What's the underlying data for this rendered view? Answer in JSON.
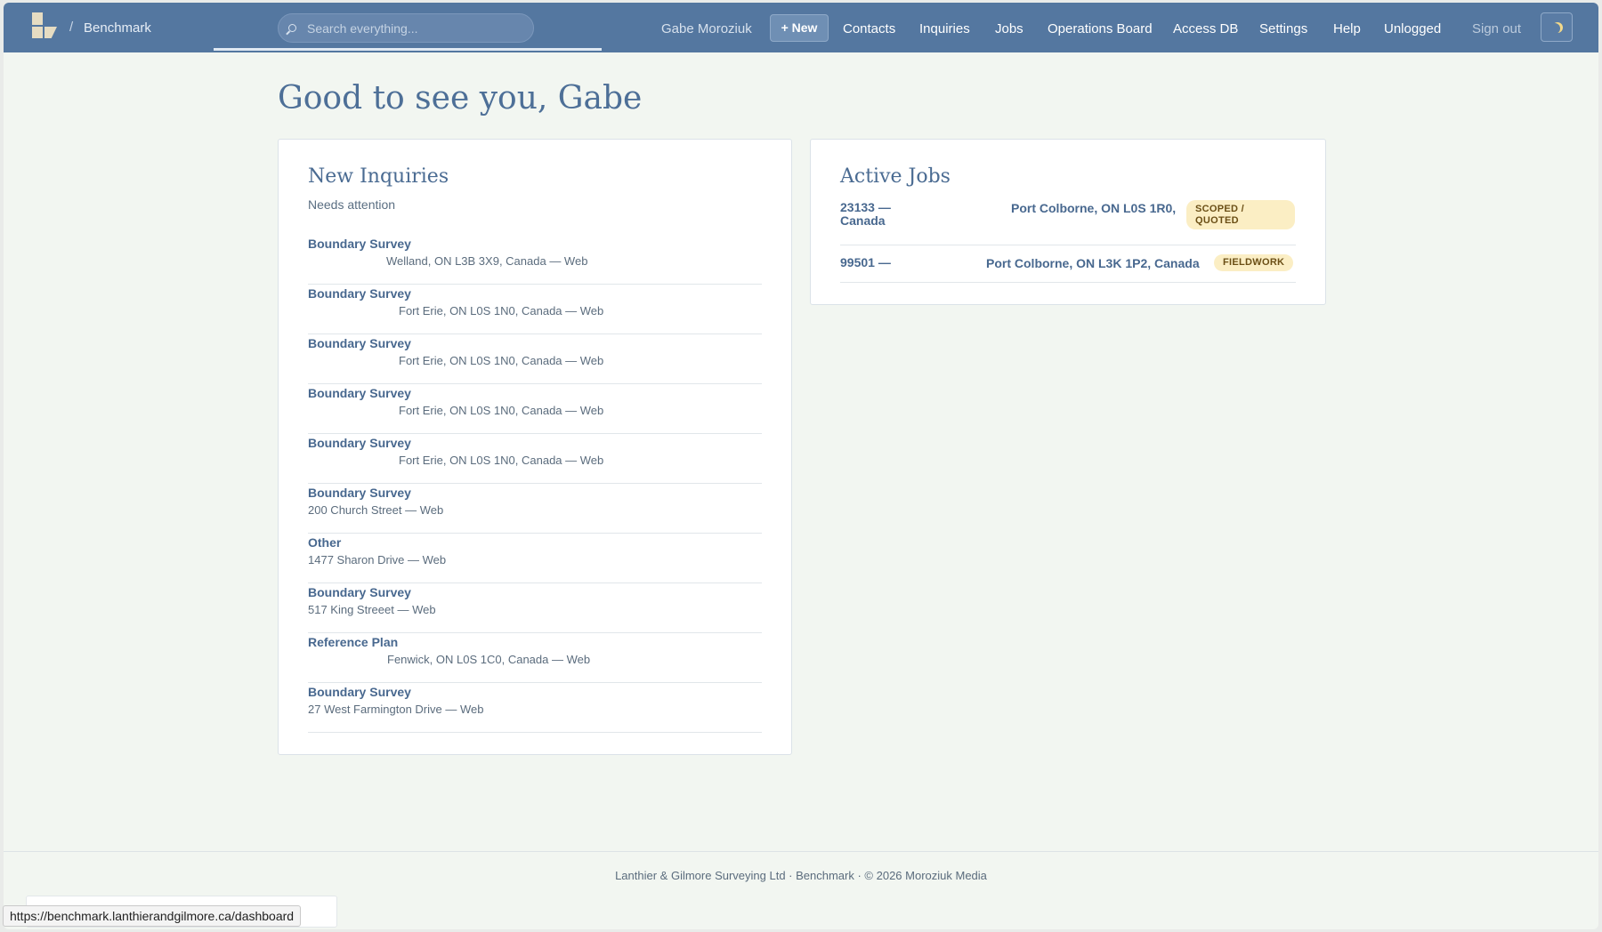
{
  "nav": {
    "app_name": "Benchmark",
    "crumb_separator": "/",
    "search_placeholder": "Search everything...",
    "user": "Gabe Moroziuk",
    "new_button": "+ New",
    "items": [
      "Contacts",
      "Inquiries",
      "Jobs",
      "Operations Board",
      "Access DB",
      "Settings",
      "Help",
      "Unlogged"
    ],
    "sign_out": "Sign out",
    "theme_icon": "moon-icon"
  },
  "greeting": "Good to see you, Gabe",
  "inquiries": {
    "title": "New Inquiries",
    "subtitle": "Needs attention",
    "items": [
      {
        "type": "Boundary Survey",
        "meta": "Welland, ON L3B 3X9, Canada — Web"
      },
      {
        "type": "Boundary Survey",
        "meta": "Fort Erie, ON L0S 1N0, Canada — Web"
      },
      {
        "type": "Boundary Survey",
        "meta": "Fort Erie, ON L0S 1N0, Canada — Web"
      },
      {
        "type": "Boundary Survey",
        "meta": "Fort Erie, ON L0S 1N0, Canada — Web"
      },
      {
        "type": "Boundary Survey",
        "meta": "Fort Erie, ON L0S 1N0, Canada — Web"
      },
      {
        "type": "Boundary Survey",
        "meta": "200 Church Street — Web"
      },
      {
        "type": "Other",
        "meta": "1477 Sharon Drive — Web"
      },
      {
        "type": "Boundary Survey",
        "meta": "517 King Streeet — Web"
      },
      {
        "type": "Reference Plan",
        "meta": "Fenwick, ON L0S 1C0, Canada — Web"
      },
      {
        "type": "Boundary Survey",
        "meta": "27 West Farmington Drive — Web"
      }
    ]
  },
  "jobs": {
    "title": "Active Jobs",
    "items": [
      {
        "number": "23133 —",
        "number_line2": "Canada",
        "address": "Port Colborne, ON L0S 1R0,",
        "status_line1": "SCOPED /",
        "status_line2": "QUOTED"
      },
      {
        "number": "99501 —",
        "address": "Port Colborne, ON L3K 1P2, Canada",
        "status": "FIELDWORK"
      }
    ]
  },
  "footer": "Lanthier & Gilmore Surveying Ltd · Benchmark · © 2026 Moroziuk Media",
  "status_url": "https://benchmark.lanthierandgilmore.ca/dashboard",
  "colors": {
    "nav_bg": "#5477a0",
    "page_bg": "#f2f6f1",
    "accent_text": "#48688f",
    "badge_bg": "#fbeec4"
  }
}
